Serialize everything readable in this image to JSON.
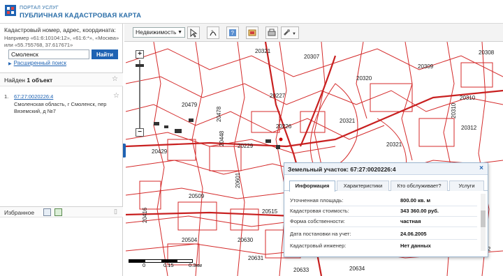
{
  "header": {
    "portal_label": "ПОРТАЛ УСЛУГ",
    "app_title": "ПУБЛИЧНАЯ КАДАСТРОВАЯ КАРТА"
  },
  "search": {
    "title": "Кадастровый номер, адрес, координата:",
    "hint": "Например «61:6:10104:12», «61:6:*», «Москва» или «55.755768, 37.617671»",
    "value": "Смоленск",
    "button": "Найти",
    "advanced_link": "Расширенный поиск"
  },
  "results": {
    "found_prefix": "Найден",
    "found_count": "1",
    "found_suffix": "объект",
    "items": [
      {
        "index": "1.",
        "number": "67:27:0020226:4",
        "address": "Смоленская область, г Смоленск, пер Вяземский, д №7"
      }
    ]
  },
  "favorites": {
    "label": "Избранное"
  },
  "toolbar": {
    "layer_select": "Недвижимость"
  },
  "map": {
    "labels": [
      "20321",
      "20307",
      "20309",
      "20308",
      "20320",
      "20310",
      "20227",
      "20479",
      "20226",
      "20321",
      "20321",
      "20312",
      "20229",
      "20448",
      "20429",
      "20602",
      "20601",
      "20509",
      "20515",
      "20630",
      "20504",
      "20631",
      "20633",
      "20634",
      "20310",
      "20322",
      "20478",
      "20416"
    ],
    "scale_labels": [
      "0",
      "0.15",
      "0.3км"
    ]
  },
  "popup": {
    "title": "Земельный участок: 67:27:0020226:4",
    "close": "×",
    "tabs": [
      "Информация",
      "Характеристики",
      "Кто обслуживает?",
      "Услуги"
    ],
    "rows": [
      {
        "key": "Уточненная площадь:",
        "value": "800.00 кв. м"
      },
      {
        "key": "Кадастровая стоимость:",
        "value": "343 360.00 руб."
      },
      {
        "key": "Форма собственности:",
        "value": "частная"
      },
      {
        "key": "Дата постановки на учет:",
        "value": "24.06.2005"
      },
      {
        "key": "Кадастровый инженер:",
        "value": "Нет данных"
      }
    ]
  }
}
